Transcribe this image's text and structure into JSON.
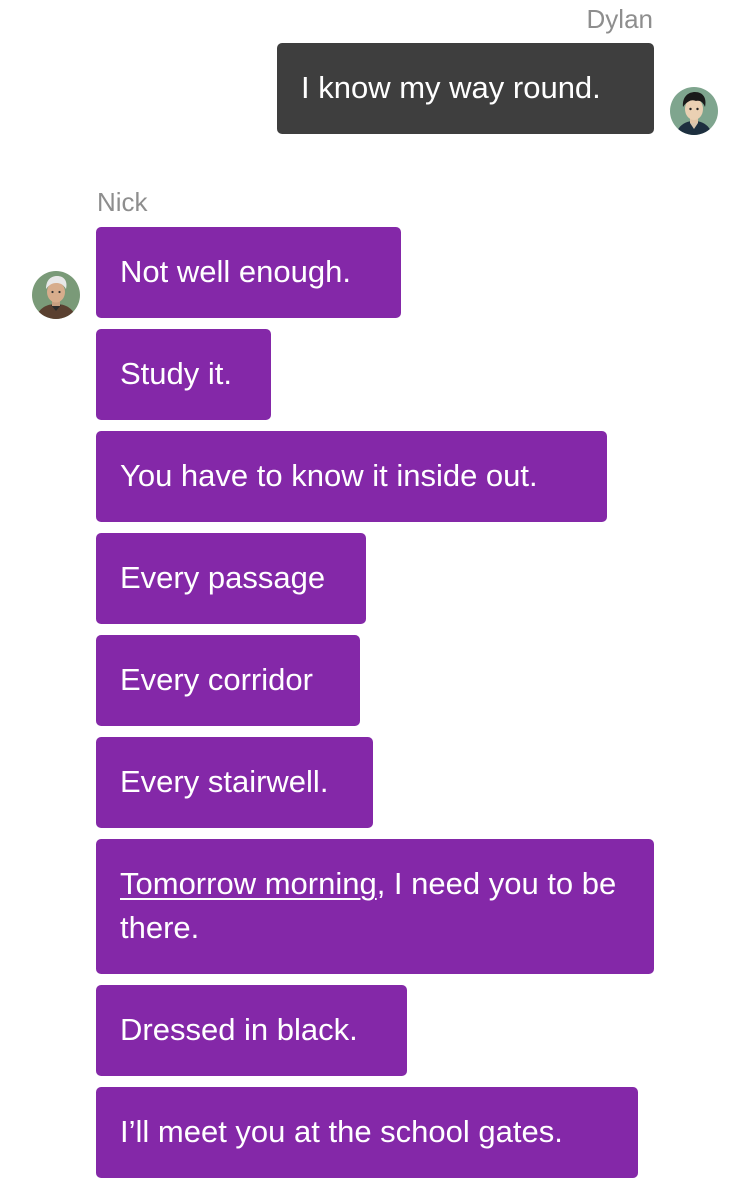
{
  "conversation": {
    "outgoing": {
      "sender": "Dylan",
      "avatar_icon": "dylan-avatar-icon",
      "messages": [
        "I know my way round."
      ]
    },
    "incoming": {
      "sender": "Nick",
      "avatar_icon": "nick-avatar-icon",
      "messages": [
        "Not well enough.",
        "Study it.",
        "You have to know it inside out.",
        "Every passage",
        "Every corridor",
        "Every stairwell.",
        "Tomorrow morning, I need you to be there.",
        "Dressed in black.",
        "I’ll meet you at the school gates."
      ],
      "link_message": {
        "link_text": "Tomorrow morning",
        "rest_text": ", I need you to be there."
      }
    }
  },
  "colors": {
    "outgoing_bubble": "#3e3e3e",
    "incoming_bubble": "#8428a8",
    "bubble_text": "#ffffff",
    "sender_name": "#8e8e8e",
    "background": "#ffffff"
  }
}
